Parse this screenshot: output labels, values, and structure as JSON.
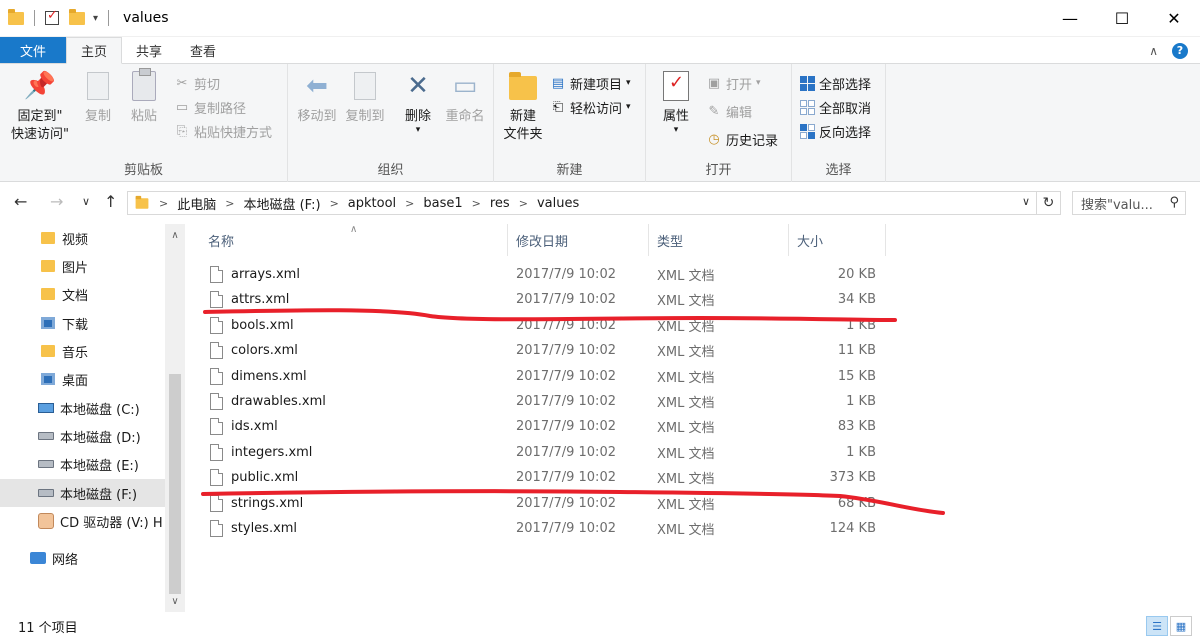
{
  "window": {
    "title": "values",
    "controls": [
      "—",
      "☐",
      "✕"
    ]
  },
  "tabs": {
    "file": "文件",
    "items": [
      "主页",
      "共享",
      "查看"
    ]
  },
  "ribbon": {
    "clipboard": {
      "label": "剪贴板",
      "pin_line1": "固定到\"",
      "pin_line2": "快速访问\"",
      "copy": "复制",
      "paste": "粘贴",
      "cut": "剪切",
      "copy_path": "复制路径",
      "paste_shortcut": "粘贴快捷方式"
    },
    "organize": {
      "label": "组织",
      "move_to": "移动到",
      "copy_to": "复制到",
      "delete": "删除",
      "rename": "重命名"
    },
    "new": {
      "label": "新建",
      "new_folder_line1": "新建",
      "new_folder_line2": "文件夹",
      "new_item": "新建项目",
      "easy_access": "轻松访问"
    },
    "open": {
      "label": "打开",
      "properties": "属性",
      "open": "打开",
      "edit": "编辑",
      "history": "历史记录"
    },
    "select": {
      "label": "选择",
      "select_all": "全部选择",
      "select_none": "全部取消",
      "invert": "反向选择"
    }
  },
  "address": {
    "crumbs": [
      "此电脑",
      "本地磁盘 (F:)",
      "apktool",
      "base1",
      "res",
      "values"
    ],
    "search_placeholder": "搜索\"valu..."
  },
  "nav": {
    "items": [
      {
        "label": "视频",
        "icon": "video-folder-icon"
      },
      {
        "label": "图片",
        "icon": "pictures-folder-icon"
      },
      {
        "label": "文档",
        "icon": "documents-folder-icon"
      },
      {
        "label": "下载",
        "icon": "downloads-folder-icon"
      },
      {
        "label": "音乐",
        "icon": "music-folder-icon"
      },
      {
        "label": "桌面",
        "icon": "desktop-folder-icon"
      },
      {
        "label": "本地磁盘 (C:)",
        "icon": "system-drive-icon"
      },
      {
        "label": "本地磁盘 (D:)",
        "icon": "drive-icon"
      },
      {
        "label": "本地磁盘 (E:)",
        "icon": "drive-icon"
      },
      {
        "label": "本地磁盘 (F:)",
        "icon": "drive-icon"
      },
      {
        "label": "CD 驱动器 (V:) H",
        "icon": "cd-drive-icon"
      },
      {
        "label": "网络",
        "icon": "network-icon"
      }
    ]
  },
  "columns": {
    "name": "名称",
    "date": "修改日期",
    "type": "类型",
    "size": "大小"
  },
  "files": [
    {
      "name": "arrays.xml",
      "date": "2017/7/9 10:02",
      "type": "XML 文档",
      "size": "20 KB"
    },
    {
      "name": "attrs.xml",
      "date": "2017/7/9 10:02",
      "type": "XML 文档",
      "size": "34 KB"
    },
    {
      "name": "bools.xml",
      "date": "2017/7/9 10:02",
      "type": "XML 文档",
      "size": "1 KB"
    },
    {
      "name": "colors.xml",
      "date": "2017/7/9 10:02",
      "type": "XML 文档",
      "size": "11 KB"
    },
    {
      "name": "dimens.xml",
      "date": "2017/7/9 10:02",
      "type": "XML 文档",
      "size": "15 KB"
    },
    {
      "name": "drawables.xml",
      "date": "2017/7/9 10:02",
      "type": "XML 文档",
      "size": "1 KB"
    },
    {
      "name": "ids.xml",
      "date": "2017/7/9 10:02",
      "type": "XML 文档",
      "size": "83 KB"
    },
    {
      "name": "integers.xml",
      "date": "2017/7/9 10:02",
      "type": "XML 文档",
      "size": "1 KB"
    },
    {
      "name": "public.xml",
      "date": "2017/7/9 10:02",
      "type": "XML 文档",
      "size": "373 KB"
    },
    {
      "name": "strings.xml",
      "date": "2017/7/9 10:02",
      "type": "XML 文档",
      "size": "68 KB"
    },
    {
      "name": "styles.xml",
      "date": "2017/7/9 10:02",
      "type": "XML 文档",
      "size": "124 KB"
    }
  ],
  "status": {
    "count": "11 个项目"
  },
  "colors": {
    "file_tab": "#1979ca",
    "annotation": "#e8202a"
  }
}
